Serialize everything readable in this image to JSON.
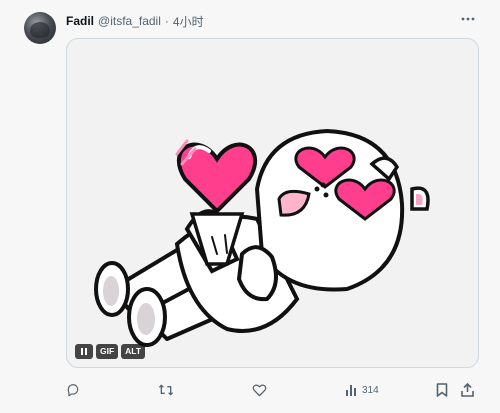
{
  "tweet": {
    "author_name": "Fadil",
    "handle": "@itsfa_fadil",
    "separator": "·",
    "time": "4小时"
  },
  "media": {
    "badges": {
      "gif": "GIF",
      "alt": "ALT"
    }
  },
  "actions": {
    "views_count": "314"
  },
  "icons": [
    "more-icon",
    "pause-icon",
    "reply-icon",
    "retweet-icon",
    "like-icon",
    "views-icon",
    "bookmark-icon",
    "share-icon"
  ],
  "colors": {
    "heart": "#ff3f8e",
    "text": "#0f1419",
    "muted": "#536471"
  }
}
